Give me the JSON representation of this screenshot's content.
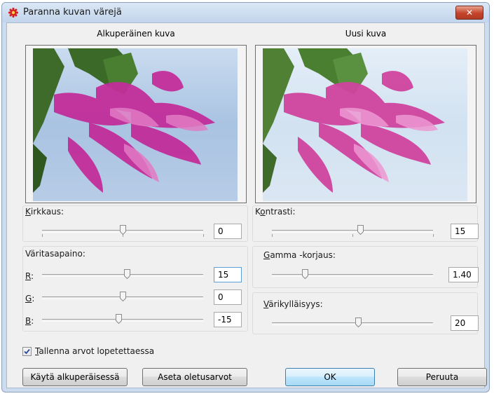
{
  "window": {
    "title": "Paranna kuvan värejä",
    "close_label": "✕"
  },
  "preview": {
    "original_caption": "Alkuperäinen kuva",
    "new_caption": "Uusi kuva"
  },
  "brightness": {
    "mnemonic": "K",
    "rest": "irkkaus:",
    "value": "0"
  },
  "contrast": {
    "pre": "K",
    "mnemonic": "o",
    "rest": "ntrasti:",
    "value": "15"
  },
  "color_balance": {
    "title": "Väritasapaino:",
    "r": {
      "mnemonic": "R",
      "rest": ":",
      "value": "15"
    },
    "g": {
      "mnemonic": "G",
      "rest": ":",
      "value": "0"
    },
    "b": {
      "mnemonic": "B",
      "rest": ":",
      "value": "-15"
    }
  },
  "gamma": {
    "mnemonic": "G",
    "rest": "amma -korjaus:",
    "value": "1.40"
  },
  "saturation": {
    "mnemonic": "V",
    "rest": "ärikylläisyys:",
    "value": "20"
  },
  "save_checkbox": {
    "mnemonic": "T",
    "rest": "allenna arvot lopetettaessa",
    "checked": true
  },
  "buttons": {
    "apply_original": "Käytä alkuperäisessä",
    "set_defaults": "Aseta oletusarvot",
    "ok": "OK",
    "cancel": "Peruuta"
  }
}
